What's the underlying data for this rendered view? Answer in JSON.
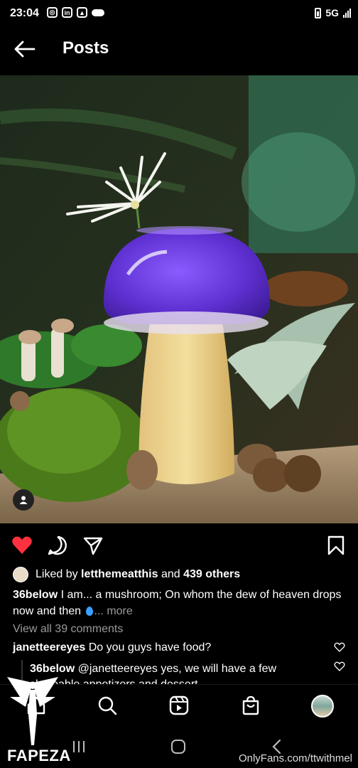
{
  "status_bar": {
    "time": "23:04",
    "network": "5G"
  },
  "header": {
    "title": "Posts"
  },
  "post": {
    "liked_prefix": "Liked by",
    "liked_user": "letthemeatthis",
    "liked_and": "and",
    "liked_others": "439 others",
    "caption_user": "36below",
    "caption_text": "I am... a mushroom; On whom the dew of heaven drops now and then",
    "caption_more": "... more",
    "view_comments": "View all 39 comments"
  },
  "comments": [
    {
      "user": "janetteereyes",
      "text": "Do you guys have food?"
    },
    {
      "user": "36below",
      "text": "@janetteereyes yes, we will have a few shareable appetizers and dessert"
    }
  ],
  "icons": {
    "like": "heart-filled-icon",
    "comment": "comment-icon",
    "share": "send-icon",
    "save": "bookmark-icon"
  },
  "colors": {
    "like": "#ff3040",
    "background": "#000000"
  },
  "watermark": {
    "brand": "FAPEZA",
    "url": "OnlyFans.com/ttwithmel"
  }
}
